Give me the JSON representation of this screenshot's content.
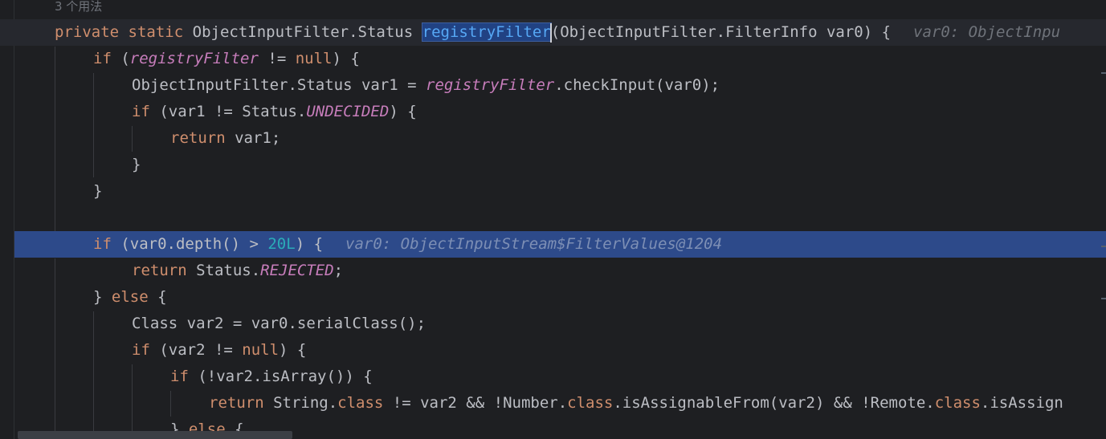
{
  "usage_hint": "3 个用法",
  "lines": {
    "l1": {
      "kw1": "private",
      "kw2": "static",
      "type": "ObjectInputFilter.Status",
      "method": "registryFilter",
      "params": "(ObjectInputFilter.FilterInfo var0) {",
      "inlay": "var0: ObjectInpu"
    },
    "l2": {
      "kw": "if",
      "open": " (",
      "field": "registryFilter",
      "op": " != ",
      "null": "null",
      "close": ") {"
    },
    "l3": {
      "pre": "ObjectInputFilter.Status var1 = ",
      "field": "registryFilter",
      "post": ".checkInput(var0);"
    },
    "l4": {
      "kw": "if",
      "pre": " (var1 != Status.",
      "field": "UNDECIDED",
      "post": ") {"
    },
    "l5": {
      "kw": "return",
      "post": " var1;"
    },
    "l6": {
      "text": "}"
    },
    "l7": {
      "text": "}"
    },
    "l9": {
      "kw": "if",
      "pre": " (var0.depth() > ",
      "num": "20L",
      "post": ") {",
      "inlay": "var0: ObjectInputStream$FilterValues@1204"
    },
    "l10": {
      "kw": "return",
      "pre": " Status.",
      "field": "REJECTED",
      "post": ";"
    },
    "l11": {
      "pre": "} ",
      "kw": "else",
      "post": " {"
    },
    "l12": {
      "text": "Class var2 = var0.serialClass();"
    },
    "l13": {
      "kw": "if",
      "pre": " (var2 != ",
      "null": "null",
      "post": ") {"
    },
    "l14": {
      "kw": "if",
      "post": " (!var2.isArray()) {"
    },
    "l15": {
      "kw": "return",
      "a": " String.",
      "k1": "class",
      "b": " != var2 && !Number.",
      "k2": "class",
      "c": ".isAssignableFrom(var2) && !Remote.",
      "k3": "class",
      "d": ".isAssign"
    },
    "l16": {
      "pre": "} ",
      "kw": "else",
      "post": " {"
    }
  },
  "colors": {
    "background": "#1e1f22",
    "keyword": "#cf8e6d",
    "field": "#c77dbb",
    "number": "#2aacb8",
    "method_decl": "#56a8f5",
    "execution_line": "#2d4a8a",
    "inlay_hint": "#6f737a"
  }
}
